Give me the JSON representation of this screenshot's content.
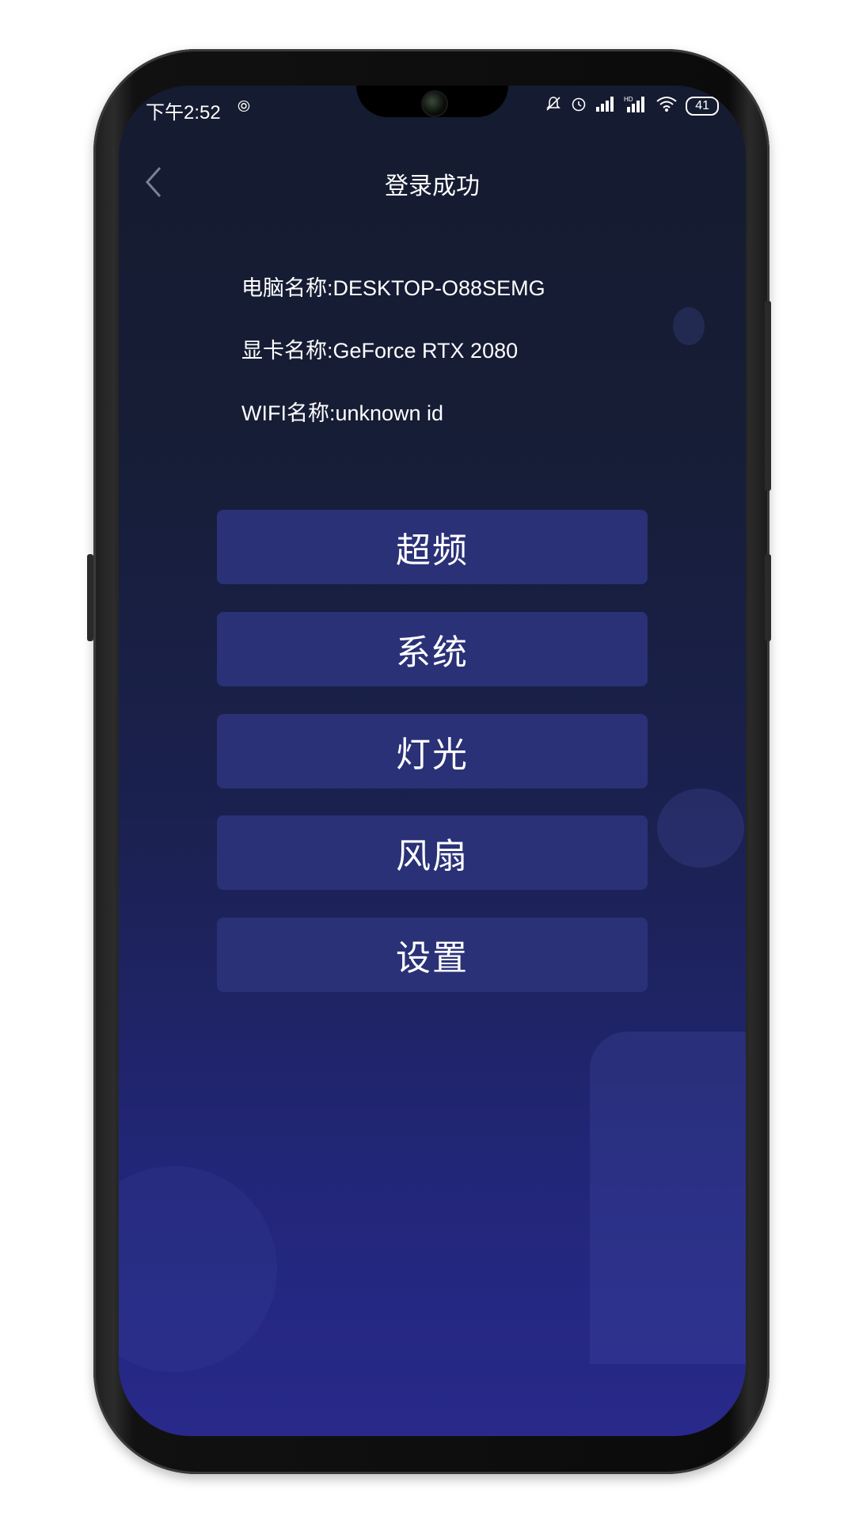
{
  "status_bar": {
    "time": "下午2:52",
    "battery": "41",
    "icons": [
      "hotspot-icon",
      "mute-icon",
      "alarm-icon",
      "signal-icon",
      "hd-signal-icon",
      "wifi-icon",
      "battery-icon"
    ]
  },
  "header": {
    "title": "登录成功",
    "back_icon": "chevron-left-icon"
  },
  "info": {
    "computer_name": "电脑名称:DESKTOP-O88SEMG",
    "gpu_name": "显卡名称:GeForce RTX 2080",
    "wifi_name": "WIFI名称:unknown id"
  },
  "menu": [
    {
      "label": "超频"
    },
    {
      "label": "系统"
    },
    {
      "label": "灯光"
    },
    {
      "label": "风扇"
    },
    {
      "label": "设置"
    }
  ],
  "colors": {
    "button_bg": "#2a3177",
    "bg_top": "#151b30",
    "bg_bottom": "#28298a",
    "text": "#ffffff"
  }
}
